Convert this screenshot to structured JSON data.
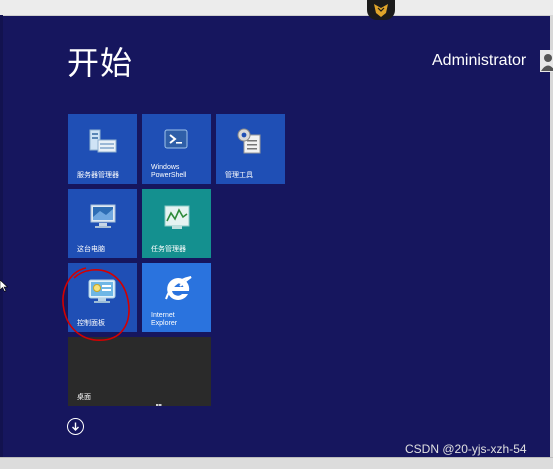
{
  "screen": {
    "title": "开始",
    "user": "Administrator",
    "watermark": "CSDN @20-yjs-xzh-54"
  },
  "tiles": [
    {
      "label": "服务器管理器",
      "color": "#1f4fb5",
      "icon": "server-manager-icon"
    },
    {
      "label": "Windows\nPowerShell",
      "color": "#1f4fb5",
      "icon": "powershell-icon"
    },
    {
      "label": "管理工具",
      "color": "#1f4fb5",
      "icon": "admin-tools-icon"
    },
    {
      "label": "这台电脑",
      "color": "#1f4fb5",
      "icon": "this-pc-icon"
    },
    {
      "label": "任务管理器",
      "color": "#14908f",
      "icon": "task-manager-icon"
    },
    {
      "label": "控制面板",
      "color": "#1f4fb5",
      "icon": "control-panel-icon"
    },
    {
      "label": "Internet\nExplorer",
      "color": "#2a73de",
      "icon": "internet-explorer-icon"
    },
    {
      "label": "桌面",
      "color": "#2a2a2a",
      "icon": "desktop-icon"
    }
  ],
  "colors": {
    "background": "#16165e",
    "annotation": "#d40000"
  }
}
